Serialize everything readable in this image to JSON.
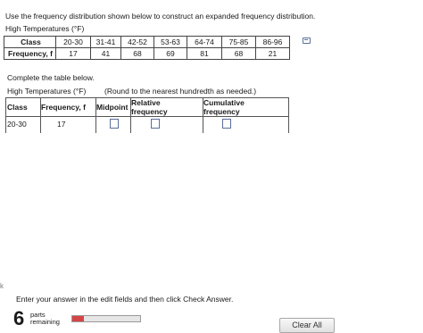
{
  "intro": "Use the frequency distribution shown below to construct an expanded frequency distribution.",
  "dist_table": {
    "caption": "High Temperatures (°F)",
    "row_labels": [
      "Class",
      "Frequency, f"
    ],
    "classes": [
      "20-30",
      "31-41",
      "42-52",
      "53-63",
      "64-74",
      "75-85",
      "86-96"
    ],
    "frequencies": [
      "17",
      "41",
      "68",
      "69",
      "81",
      "68",
      "21"
    ]
  },
  "icons": {
    "copy": "copy-data-icon"
  },
  "complete_prompt": "Complete the table below.",
  "answer_table": {
    "caption": "High Temperatures (°F)",
    "round_note": "(Round to the nearest hundredth as needed.)",
    "headers": {
      "class": "Class",
      "frequency": "Frequency, f",
      "midpoint": "Midpoint",
      "relative_line1": "Relative",
      "relative_line2": "frequency",
      "cumulative_line1": "Cumulative",
      "cumulative_line2": "frequency"
    },
    "row": {
      "class": "20-30",
      "frequency": "17"
    }
  },
  "left_edge_mark": "k",
  "instruction": "Enter your answer in the edit fields and then click Check Answer.",
  "parts": {
    "count": "6",
    "label_line1": "parts",
    "label_line2": "remaining",
    "progress_fraction": 0.17
  },
  "clear_button": "Clear All",
  "colors": {
    "progress_fill": "#d64545",
    "input_border": "#5a6f99"
  }
}
